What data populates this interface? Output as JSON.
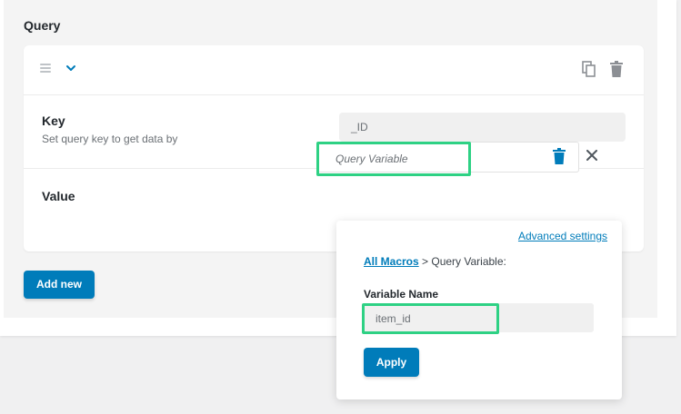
{
  "section": {
    "title": "Query"
  },
  "key_row": {
    "label": "Key",
    "description": "Set query key to get data by",
    "value": "_ID"
  },
  "value_row": {
    "label": "Value",
    "selected_macro": "Query Variable"
  },
  "add_new_label": "Add new",
  "macro_popup": {
    "advanced_settings": "Advanced settings",
    "breadcrumb_link": "All Macros",
    "breadcrumb_rest": " > Query Variable:",
    "variable_name_label": "Variable Name",
    "variable_name_value": "item_id",
    "apply_label": "Apply"
  },
  "colors": {
    "accent": "#007cba",
    "highlight": "#2ed184"
  },
  "icons": [
    "drag-handle-icon",
    "chevron-down-icon",
    "copy-icon",
    "trash-icon",
    "close-icon"
  ]
}
